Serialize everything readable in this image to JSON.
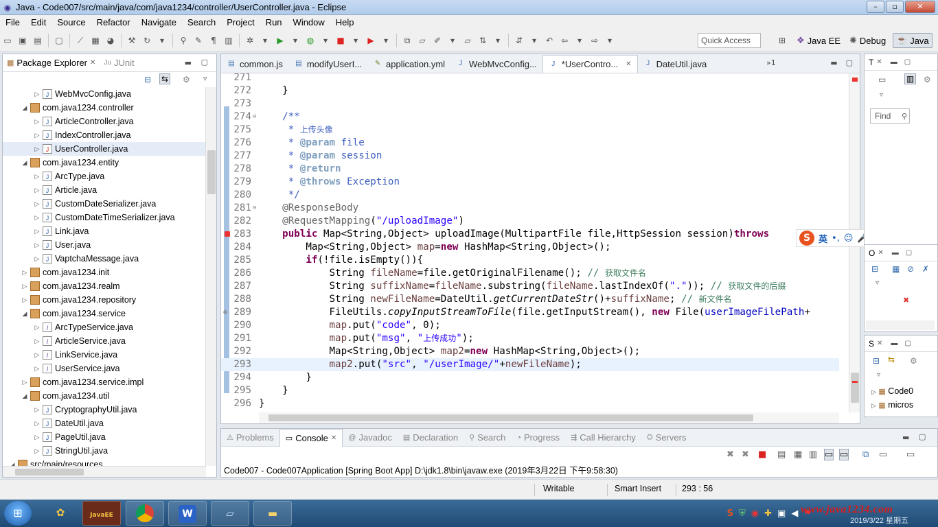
{
  "window": {
    "title": "Java - Code007/src/main/java/com/java1234/controller/UserController.java - Eclipse",
    "buttons": [
      "–",
      "▫",
      "✕"
    ]
  },
  "menu": [
    "File",
    "Edit",
    "Source",
    "Refactor",
    "Navigate",
    "Search",
    "Project",
    "Run",
    "Window",
    "Help"
  ],
  "toolbar": {
    "quick_access": "Quick Access",
    "perspectives": [
      {
        "label": "Java EE",
        "active": false
      },
      {
        "label": "Debug",
        "active": false
      },
      {
        "label": "Java",
        "active": true
      }
    ]
  },
  "package_explorer": {
    "tabs": [
      {
        "label": "Package Explorer",
        "active": true
      },
      {
        "label": "JUnit",
        "active": false
      }
    ],
    "items": [
      {
        "label": "WebMvcConfig.java",
        "kind": "java",
        "level": 2,
        "twist": "▷"
      },
      {
        "label": "com.java1234.controller",
        "kind": "pkg",
        "level": 1,
        "twist": "◢"
      },
      {
        "label": "ArticleController.java",
        "kind": "java",
        "level": 2,
        "twist": "▷"
      },
      {
        "label": "IndexController.java",
        "kind": "java",
        "level": 2,
        "twist": "▷"
      },
      {
        "label": "UserController.java",
        "kind": "err",
        "level": 2,
        "twist": "▷",
        "selected": true
      },
      {
        "label": "com.java1234.entity",
        "kind": "pkg",
        "level": 1,
        "twist": "◢"
      },
      {
        "label": "ArcType.java",
        "kind": "java",
        "level": 2,
        "twist": "▷"
      },
      {
        "label": "Article.java",
        "kind": "java",
        "level": 2,
        "twist": "▷"
      },
      {
        "label": "CustomDateSerializer.java",
        "kind": "java",
        "level": 2,
        "twist": "▷"
      },
      {
        "label": "CustomDateTimeSerializer.java",
        "kind": "java",
        "level": 2,
        "twist": "▷"
      },
      {
        "label": "Link.java",
        "kind": "java",
        "level": 2,
        "twist": "▷"
      },
      {
        "label": "User.java",
        "kind": "java",
        "level": 2,
        "twist": "▷"
      },
      {
        "label": "VaptchaMessage.java",
        "kind": "java",
        "level": 2,
        "twist": "▷"
      },
      {
        "label": "com.java1234.init",
        "kind": "pkg",
        "level": 1,
        "twist": "▷"
      },
      {
        "label": "com.java1234.realm",
        "kind": "pkg",
        "level": 1,
        "twist": "▷"
      },
      {
        "label": "com.java1234.repository",
        "kind": "pkg",
        "level": 1,
        "twist": "▷"
      },
      {
        "label": "com.java1234.service",
        "kind": "pkg",
        "level": 1,
        "twist": "◢"
      },
      {
        "label": "ArcTypeService.java",
        "kind": "iface",
        "level": 2,
        "twist": "▷"
      },
      {
        "label": "ArticleService.java",
        "kind": "iface",
        "level": 2,
        "twist": "▷"
      },
      {
        "label": "LinkService.java",
        "kind": "iface",
        "level": 2,
        "twist": "▷"
      },
      {
        "label": "UserService.java",
        "kind": "iface",
        "level": 2,
        "twist": "▷"
      },
      {
        "label": "com.java1234.service.impl",
        "kind": "pkg",
        "level": 1,
        "twist": "▷"
      },
      {
        "label": "com.java1234.util",
        "kind": "pkg",
        "level": 1,
        "twist": "◢"
      },
      {
        "label": "CryptographyUtil.java",
        "kind": "java",
        "level": 2,
        "twist": "▷"
      },
      {
        "label": "DateUtil.java",
        "kind": "java",
        "level": 2,
        "twist": "▷"
      },
      {
        "label": "PageUtil.java",
        "kind": "java",
        "level": 2,
        "twist": "▷"
      },
      {
        "label": "StringUtil.java",
        "kind": "java",
        "level": 2,
        "twist": "▷"
      },
      {
        "label": "src/main/resources",
        "kind": "pkg",
        "level": 0,
        "twist": "◢"
      }
    ]
  },
  "editor": {
    "tabs": [
      {
        "label": "common.js",
        "icon": "js",
        "active": false
      },
      {
        "label": "modifyUserI...",
        "icon": "html",
        "active": false
      },
      {
        "label": "application.yml",
        "icon": "yml",
        "active": false
      },
      {
        "label": "WebMvcConfig...",
        "icon": "java",
        "active": false
      },
      {
        "label": "*UserContro...",
        "icon": "java",
        "active": true,
        "closable": true
      },
      {
        "label": "DateUtil.java",
        "icon": "java",
        "active": false
      }
    ],
    "overflow": "»1",
    "lines": [
      {
        "n": "271",
        "t": ""
      },
      {
        "n": "272",
        "t": "    }"
      },
      {
        "n": "273",
        "t": ""
      },
      {
        "n": "274",
        "t": "    /**"
      },
      {
        "n": "275",
        "t": "     * 上传头像"
      },
      {
        "n": "276",
        "t": "     * @param file"
      },
      {
        "n": "277",
        "t": "     * @param session"
      },
      {
        "n": "278",
        "t": "     * @return"
      },
      {
        "n": "279",
        "t": "     * @throws Exception"
      },
      {
        "n": "280",
        "t": "     */"
      },
      {
        "n": "281",
        "t": "    @ResponseBody"
      },
      {
        "n": "282",
        "t": "    @RequestMapping(\"/uploadImage\")"
      },
      {
        "n": "283",
        "t": "    public Map<String,Object> uploadImage(MultipartFile file,HttpSession session)throws"
      },
      {
        "n": "284",
        "t": "        Map<String,Object> map=new HashMap<String,Object>();"
      },
      {
        "n": "285",
        "t": "        if(!file.isEmpty()){"
      },
      {
        "n": "286",
        "t": "            String fileName=file.getOriginalFilename(); // 获取文件名"
      },
      {
        "n": "287",
        "t": "            String suffixName=fileName.substring(fileName.lastIndexOf(\".\")); // 获取文件的后缀"
      },
      {
        "n": "288",
        "t": "            String newFileName=DateUtil.getCurrentDateStr()+suffixName; // 新文件名"
      },
      {
        "n": "289",
        "t": "            FileUtils.copyInputStreamToFile(file.getInputStream(), new File(userImageFilePath+"
      },
      {
        "n": "290",
        "t": "            map.put(\"code\", 0);"
      },
      {
        "n": "291",
        "t": "            map.put(\"msg\", \"上传成功\");"
      },
      {
        "n": "292",
        "t": "            Map<String,Object> map2=new HashMap<String,Object>();"
      },
      {
        "n": "293",
        "t": "            map2.put(\"src\", \"/userImage/\"+newFileName);"
      },
      {
        "n": "294",
        "t": "        }"
      },
      {
        "n": "295",
        "t": "    }"
      },
      {
        "n": "296",
        "t": "}"
      }
    ]
  },
  "ime": {
    "logo": "S",
    "lang": "英",
    "icons": [
      "•,",
      "☺",
      "🎤",
      "⌨",
      "👕",
      "✥",
      "⊞"
    ]
  },
  "right_panels": {
    "task_tab": "T",
    "find": "Find",
    "outline_tab": "O",
    "servers_tab": "S",
    "servers_items": [
      "Code0",
      "micros"
    ]
  },
  "console": {
    "tabs": [
      {
        "label": "Problems",
        "active": false
      },
      {
        "label": "Console",
        "active": true
      },
      {
        "label": "Javadoc",
        "active": false
      },
      {
        "label": "Declaration",
        "active": false
      },
      {
        "label": "Search",
        "active": false
      },
      {
        "label": "Progress",
        "active": false
      },
      {
        "label": "Call Hierarchy",
        "active": false
      },
      {
        "label": "Servers",
        "active": false
      }
    ],
    "text": "Code007 - Code007Application [Spring Boot App] D:\\jdk1.8\\bin\\javaw.exe (2019年3月22日 下午9:58:30)"
  },
  "status": {
    "writable": "Writable",
    "insert_mode": "Smart Insert",
    "position": "293 : 56"
  },
  "taskbar": {
    "apps": [
      "Java EE IDE",
      "Chrome",
      "WPS",
      "Notepad",
      "Explorer"
    ],
    "watermark": "www.java1234.com",
    "date": "2019/3/22 星期五"
  },
  "colors": {
    "accent": "#5b8ec9",
    "error": "#e33333",
    "keyword": "#7f0055",
    "string": "#2a00ff",
    "comment": "#3f5fbf"
  }
}
